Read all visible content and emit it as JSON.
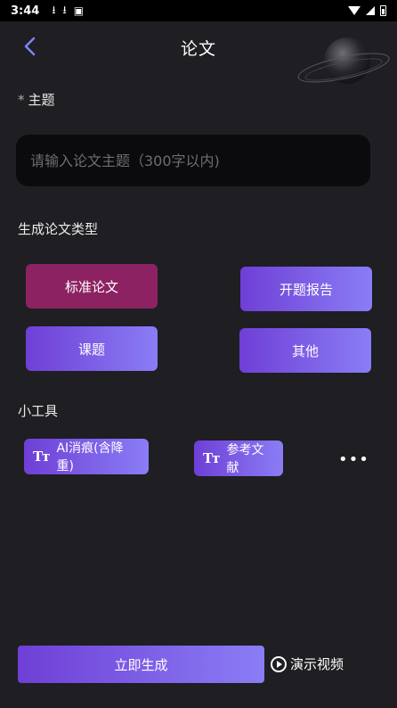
{
  "status_bar": {
    "time": "3:44",
    "icons": [
      "download-icon",
      "download-icon",
      "notification-icon",
      "wifi-icon",
      "signal-icon",
      "battery-icon"
    ]
  },
  "header": {
    "title": "论文",
    "back_icon": "chevron-left-icon"
  },
  "topic": {
    "label": "主题",
    "required_mark": "*",
    "placeholder": "请输入论文主题（300字以内)",
    "value": ""
  },
  "paper_type": {
    "label": "生成论文类型",
    "options": [
      {
        "label": "标准论文",
        "selected": true
      },
      {
        "label": "开题报告",
        "selected": false
      },
      {
        "label": "课题",
        "selected": false
      },
      {
        "label": "其他",
        "selected": false
      }
    ]
  },
  "tools": {
    "label": "小工具",
    "items": [
      {
        "icon_text": "Tт",
        "label": "AI消痕(含降重)"
      },
      {
        "icon_text": "Tт",
        "label": "参考文献"
      }
    ],
    "more": "•••"
  },
  "actions": {
    "generate_label": "立即生成",
    "demo_label": "演示视频"
  },
  "colors": {
    "background": "#1e1e23",
    "accent_start": "#6f3fd6",
    "accent_end": "#8a7df5",
    "selected": "#8d2262"
  }
}
